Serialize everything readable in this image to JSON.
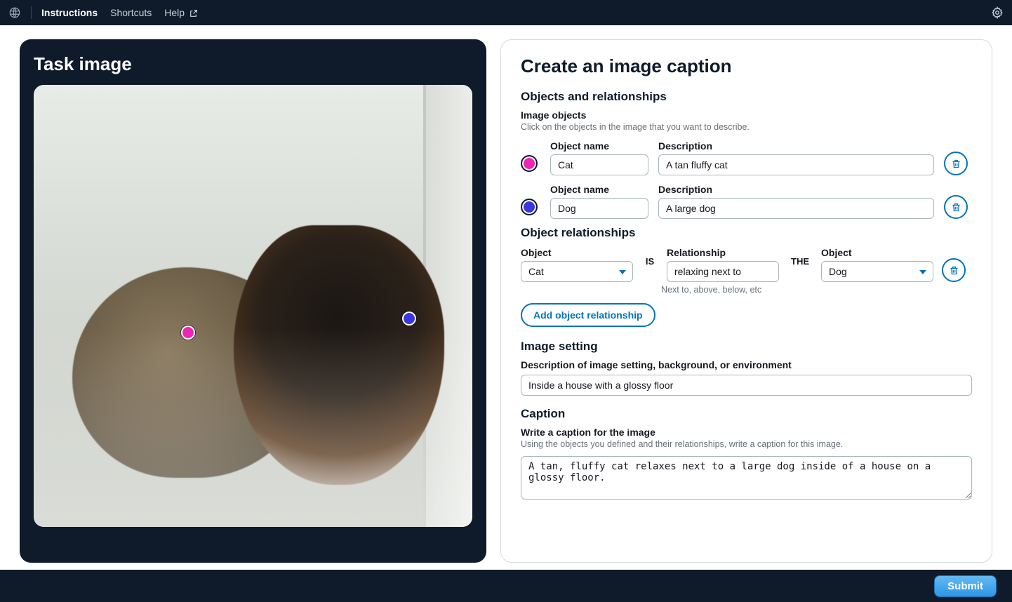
{
  "topbar": {
    "nav": {
      "instructions": "Instructions",
      "shortcuts": "Shortcuts",
      "help": "Help"
    }
  },
  "left": {
    "title": "Task image",
    "markers": [
      {
        "color": "pink",
        "object_index": 0
      },
      {
        "color": "blue",
        "object_index": 1
      }
    ]
  },
  "right": {
    "title": "Create an image caption",
    "sections": {
      "objects_heading": "Objects and relationships",
      "image_objects_label": "Image objects",
      "image_objects_hint": "Click on the objects in the image that you want to describe.",
      "object_name_label": "Object name",
      "description_label": "Description",
      "objects": [
        {
          "marker_color": "#ed24b6",
          "name": "Cat",
          "description": "A tan fluffy cat"
        },
        {
          "marker_color": "#3a36e0",
          "name": "Dog",
          "description": "A large dog"
        }
      ],
      "relationships_heading": "Object relationships",
      "rel_labels": {
        "object": "Object",
        "relationship": "Relationship",
        "is": "IS",
        "the": "THE"
      },
      "relationships": [
        {
          "subject": "Cat",
          "relation": "relaxing next to",
          "object": "Dog"
        }
      ],
      "rel_hint": "Next to, above, below, etc",
      "add_relationship_btn": "Add object relationship",
      "setting_heading": "Image setting",
      "setting_label": "Description of image setting, background, or environment",
      "setting_value": "Inside a house with a glossy floor",
      "caption_heading": "Caption",
      "caption_label": "Write a caption for the image",
      "caption_hint": "Using the objects you defined and their relationships, write a caption for this image.",
      "caption_value": "A tan, fluffy cat relaxes next to a large dog inside of a house on a glossy floor."
    }
  },
  "footer": {
    "submit_label": "Submit"
  },
  "colors": {
    "accent": "#0073bb",
    "header_bg": "#0f1b2a",
    "marker_pink": "#ed24b6",
    "marker_blue": "#3a36e0"
  }
}
